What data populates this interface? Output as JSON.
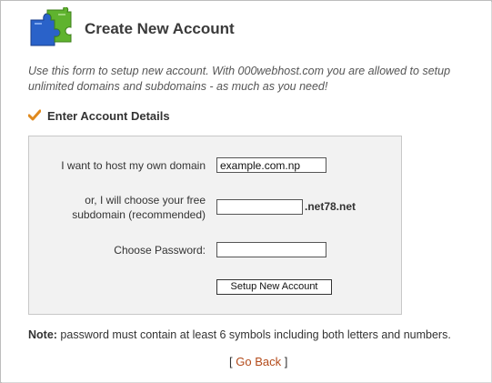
{
  "header": {
    "title": "Create New Account",
    "logo_icon": "puzzle-piece-icon"
  },
  "intro": "Use this form to setup new account. With 000webhost.com you are allowed to setup unlimited domains and subdomains - as much as you need!",
  "section": {
    "title": "Enter Account Details",
    "icon": "checkmark-icon"
  },
  "form": {
    "domain_label": "I want to host my own domain",
    "domain_value": "example.com.np",
    "subdomain_label_line1": "or, I will choose your free",
    "subdomain_label_line2": "subdomain (recommended)",
    "subdomain_value": "",
    "subdomain_suffix": ".net78.net",
    "password_label": "Choose Password:",
    "password_value": "",
    "submit_label": "Setup New Account"
  },
  "note": {
    "prefix": "Note:",
    "text": " password must contain at least 6 symbols including both letters and numbers."
  },
  "back": {
    "open": "[ ",
    "label": "Go Back",
    "close": " ]"
  },
  "colors": {
    "link": "#b34a1a",
    "panel_bg": "#f2f2f2",
    "puzzle_blue": "#2a62c9",
    "puzzle_green": "#5fb32e",
    "check_orange": "#e08a1e"
  }
}
